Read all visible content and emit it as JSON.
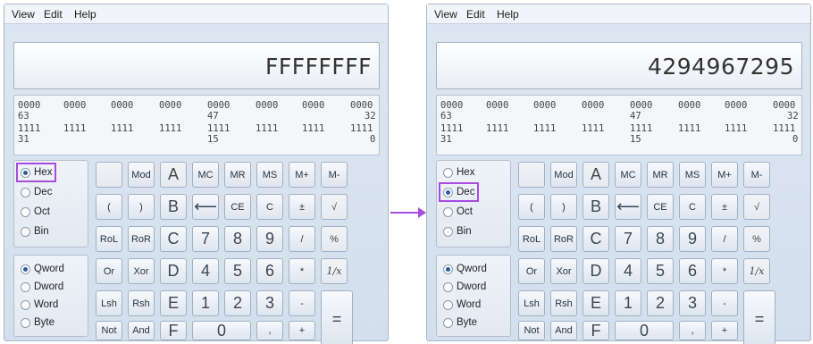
{
  "menu": {
    "view": "View",
    "edit": "Edit",
    "help": "Help"
  },
  "left": {
    "display": "FFFFFFFF",
    "selected_base": "Hex"
  },
  "right": {
    "display": "4294967295",
    "selected_base": "Dec"
  },
  "bits": {
    "row1": [
      "0000",
      "0000",
      "0000",
      "0000",
      "0000",
      "0000",
      "0000",
      "0000"
    ],
    "row1_labels": [
      "63",
      "47",
      "32"
    ],
    "row2": [
      "1111",
      "1111",
      "1111",
      "1111",
      "1111",
      "1111",
      "1111",
      "1111"
    ],
    "row2_labels": [
      "31",
      "15",
      "0"
    ]
  },
  "radios": {
    "base": [
      "Hex",
      "Dec",
      "Oct",
      "Bin"
    ],
    "word": [
      "Qword",
      "Dword",
      "Word",
      "Byte"
    ],
    "selected_word": "Qword"
  },
  "keys": {
    "mod": "Mod",
    "a": "A",
    "mc": "MC",
    "mr": "MR",
    "ms": "MS",
    "mplus": "M+",
    "mminus": "M-",
    "lparen": "(",
    "rparen": ")",
    "b": "B",
    "back": "⟵",
    "ce": "CE",
    "c": "C",
    "pm": "±",
    "sqrt": "√",
    "rol": "RoL",
    "ror": "RoR",
    "hc": "C",
    "n7": "7",
    "n8": "8",
    "n9": "9",
    "div": "/",
    "pct": "%",
    "or": "Or",
    "xor": "Xor",
    "d": "D",
    "n4": "4",
    "n5": "5",
    "n6": "6",
    "mul": "*",
    "inv": "1/x",
    "lsh": "Lsh",
    "rsh": "Rsh",
    "e": "E",
    "n1": "1",
    "n2": "2",
    "n3": "3",
    "sub": "-",
    "eq": "=",
    "not": "Not",
    "and": "And",
    "f": "F",
    "n0": "0",
    "dot": ",",
    "add": "+"
  },
  "colors": {
    "highlight": "#a64ce0",
    "window": "#d8e3ef"
  }
}
